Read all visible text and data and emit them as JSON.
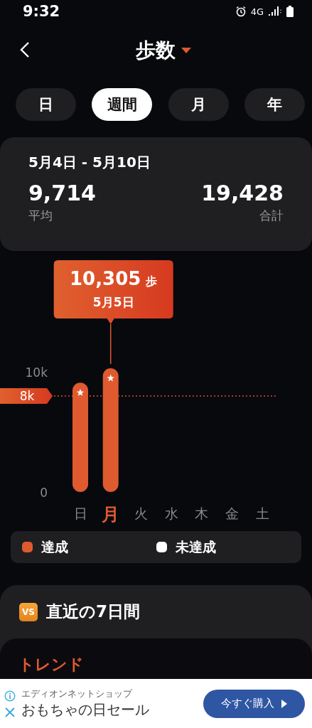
{
  "status_bar": {
    "time": "9:32",
    "network": "4G"
  },
  "header": {
    "title": "歩数"
  },
  "tabs": [
    {
      "label": "日",
      "selected": false
    },
    {
      "label": "週間",
      "selected": true
    },
    {
      "label": "月",
      "selected": false
    },
    {
      "label": "年",
      "selected": false
    }
  ],
  "summary": {
    "range": "5月4日 - 5月10日",
    "average": "9,714",
    "average_label": "平均",
    "total": "19,428",
    "total_label": "合計"
  },
  "chart": {
    "tooltip": {
      "value": "10,305",
      "unit": "歩",
      "date": "5月5日"
    },
    "highlighted": [
      false,
      true,
      false,
      false,
      false,
      false,
      false
    ],
    "chart_data": {
      "type": "bar",
      "categories": [
        "日",
        "月",
        "火",
        "水",
        "木",
        "金",
        "土"
      ],
      "values": [
        9100,
        10305,
        null,
        null,
        null,
        null,
        null
      ],
      "ylim": [
        0,
        10305
      ],
      "yticks": [
        {
          "value": 0,
          "label": "0"
        },
        {
          "value": 10000,
          "label": "10k"
        }
      ],
      "ref_lines": [
        {
          "axis": "y",
          "value": 8000,
          "label": "8k"
        }
      ]
    }
  },
  "legend": [
    {
      "label": "達成",
      "color": "#e05a30"
    },
    {
      "label": "未達成",
      "color": "#ffffff"
    }
  ],
  "comparison": {
    "badge": "VS",
    "title": "直近の7日間",
    "trend_title": "トレンド"
  },
  "ad": {
    "advertiser": "エディオンネットショップ",
    "headline": "おもちゃの日セール",
    "button": "今すぐ購入"
  }
}
